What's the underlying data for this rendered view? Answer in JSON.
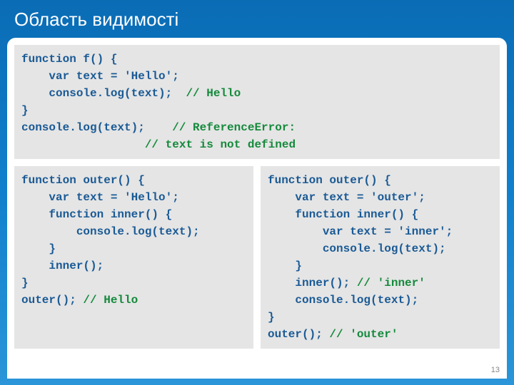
{
  "title": "Область видимості",
  "pageNumber": "13",
  "top": {
    "l1a": "function f() {",
    "l2a": "    var text = 'Hello';",
    "l3a": "    console.log(text);  ",
    "l3c": "// Hello",
    "l4a": "}",
    "l5a": "console.log(text);    ",
    "l5c": "// ReferenceError:",
    "l6pad": "                  ",
    "l6c": "// text is not defined"
  },
  "left": {
    "l1": "function outer() {",
    "l2": "    var text = 'Hello';",
    "l3": "    function inner() {",
    "l4": "        console.log(text);",
    "l5": "    }",
    "l6": "    inner();",
    "l7": "}",
    "l8a": "outer(); ",
    "l8c": "// Hello"
  },
  "right": {
    "l1": "function outer() {",
    "l2": "    var text = 'outer';",
    "l3": "    function inner() {",
    "l4": "        var text = 'inner';",
    "l5": "        console.log(text);",
    "l6": "    }",
    "l7a": "    inner(); ",
    "l7c": "// 'inner'",
    "l8": "    console.log(text);",
    "l9": "}",
    "l10a": "outer(); ",
    "l10c": "// 'outer'"
  }
}
